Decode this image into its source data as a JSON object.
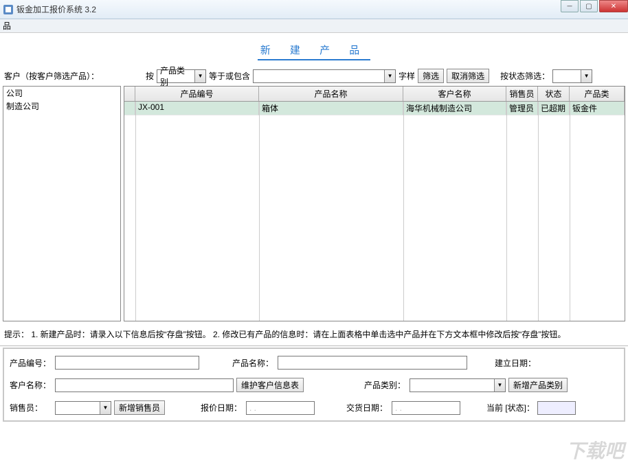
{
  "window": {
    "title": "钣金加工报价系统 3.2"
  },
  "menubar": {
    "item0": "品"
  },
  "heading": "新 建 产 品",
  "filter": {
    "customer_label": "客户（按客户筛选产品）：",
    "by_label": "按",
    "category_option": "产品类别",
    "cond_label": "等于或包含",
    "value": "",
    "suffix_label": "字样",
    "filter_btn": "筛选",
    "cancel_btn": "取消筛选",
    "status_label": "按状态筛选：",
    "status_value": ""
  },
  "sidebar": {
    "items": [
      "公司",
      "制造公司"
    ]
  },
  "grid": {
    "headers": [
      "",
      "产品编号",
      "产品名称",
      "客户名称",
      "销售员",
      "状态",
      "产品类"
    ],
    "rows": [
      {
        "cells": [
          "",
          "JX-001",
          "箱体",
          "海华机械制造公司",
          "管理员",
          "已超期",
          "钣金件"
        ]
      }
    ]
  },
  "hint": "提示：  1. 新建产品时：请录入以下信息后按“存盘”按钮。    2.  修改已有产品的信息时：请在上面表格中单击选中产品并在下方文本框中修改后按“存盘”按钮。",
  "form": {
    "product_no_lbl": "产品编号：",
    "product_name_lbl": "产品名称：",
    "create_date_lbl": "建立日期：",
    "customer_name_lbl": "客户名称：",
    "maintain_customer_btn": "维护客户信息表",
    "category_lbl": "产品类别：",
    "add_category_btn": "新增产品类别",
    "salesman_lbl": "销售员：",
    "add_salesman_btn": "新增销售员",
    "quote_date_lbl": "报价日期：",
    "delivery_date_lbl": "交货日期：",
    "current_status_lbl": "当前 [状态]：",
    "date_placeholder": "    .  .  "
  },
  "watermark": "下载吧"
}
